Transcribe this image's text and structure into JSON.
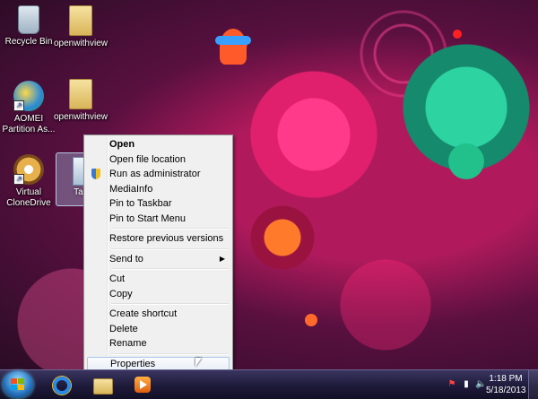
{
  "desktop": {
    "icons": [
      {
        "label": "Recycle Bin"
      },
      {
        "label": "openwithview"
      },
      {
        "label": "AOMEI Partition As..."
      },
      {
        "label": "openwithview"
      },
      {
        "label": "Virtual CloneDrive"
      }
    ],
    "selected_icon_label": "TaskN"
  },
  "context_menu": {
    "items": {
      "open": "Open",
      "open_file_location": "Open file location",
      "run_as_admin": "Run as administrator",
      "mediainfo": "MediaInfo",
      "pin_taskbar": "Pin to Taskbar",
      "pin_start": "Pin to Start Menu",
      "restore_versions": "Restore previous versions",
      "send_to": "Send to",
      "cut": "Cut",
      "copy": "Copy",
      "create_shortcut": "Create shortcut",
      "delete": "Delete",
      "rename": "Rename",
      "properties": "Properties"
    },
    "hovered_item": "properties",
    "submenu_arrow": "▶"
  },
  "taskbar": {
    "pinned": [
      "internet-explorer-icon",
      "windows-explorer-icon",
      "media-player-icon"
    ],
    "tray": {
      "flag": "⚑",
      "network": "▮",
      "volume": "🔈"
    },
    "clock": {
      "time": "1:18 PM",
      "date": "5/18/2013"
    }
  },
  "colors": {
    "menu_bg": "#f0f0f0",
    "menu_hover": "#e8eff8",
    "taskbar": "#1e1a3a"
  }
}
